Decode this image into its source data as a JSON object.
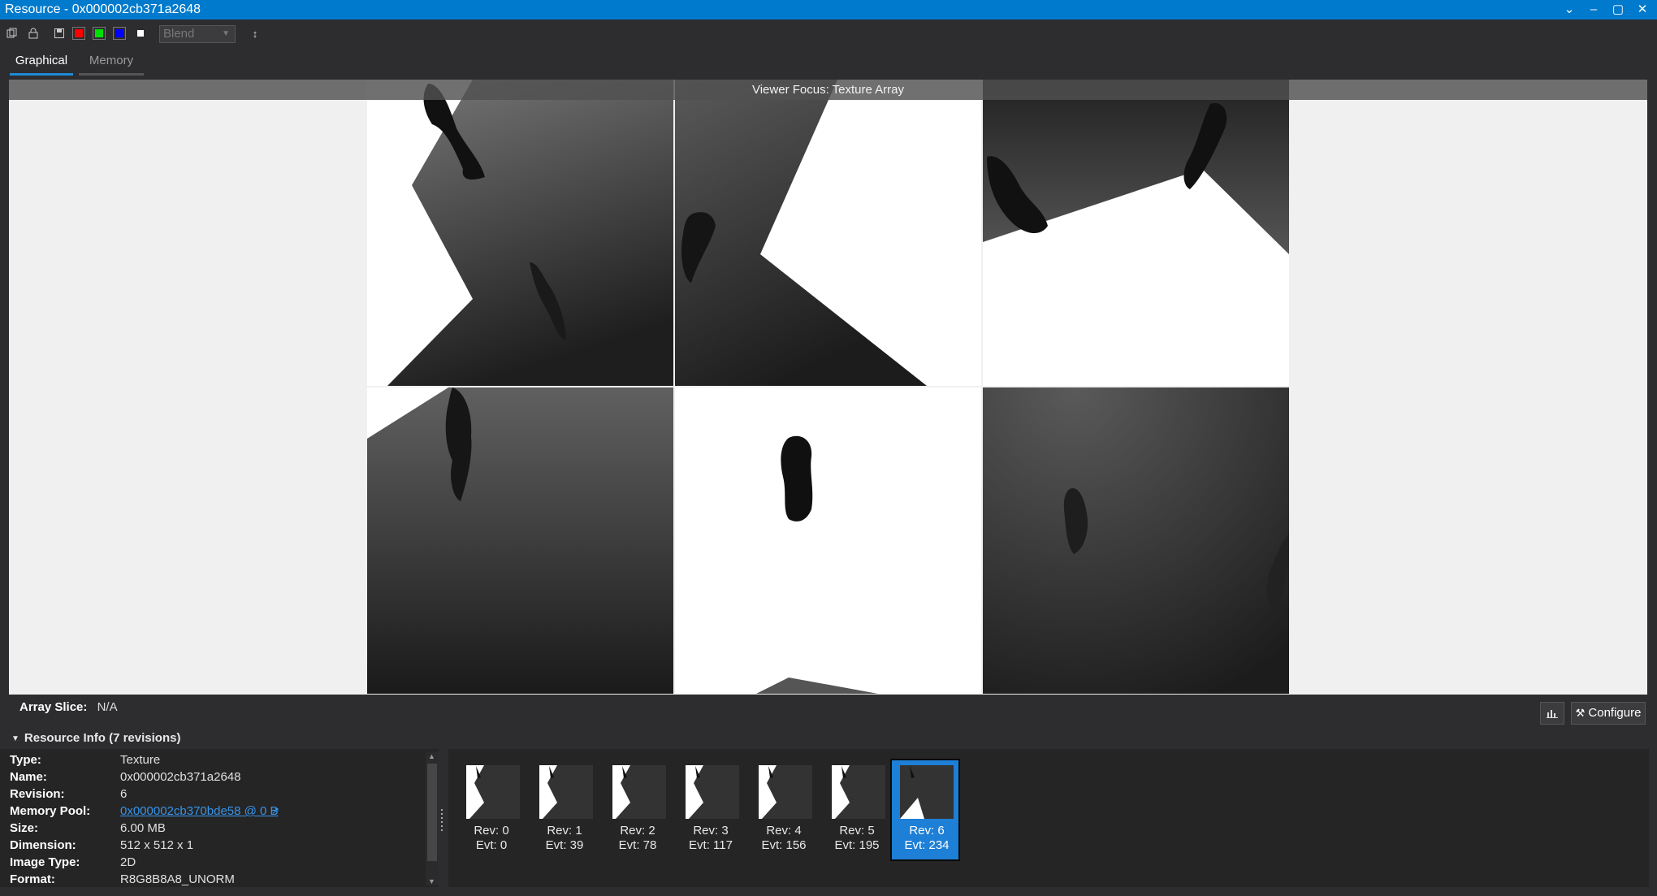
{
  "window": {
    "title": "Resource - 0x000002cb371a2648",
    "controls": [
      "menu-arrow",
      "minimize",
      "maximize",
      "close"
    ]
  },
  "toolbar": {
    "blend_value": "Blend",
    "swatches": [
      {
        "name": "red-channel",
        "color": "#ff0000"
      },
      {
        "name": "green-channel",
        "color": "#00e000"
      },
      {
        "name": "blue-channel",
        "color": "#0000ff"
      },
      {
        "name": "alpha-channel",
        "color": "#ffffff"
      }
    ]
  },
  "tabs": [
    {
      "label": "Graphical",
      "active": true
    },
    {
      "label": "Memory",
      "active": false
    }
  ],
  "viewer": {
    "focus_label": "Viewer Focus: Texture Array",
    "array_slice_label": "Array Slice:",
    "array_slice_value": "N/A",
    "configure_label": "Configure"
  },
  "resource_info": {
    "header": "Resource Info (7 revisions)",
    "rows": [
      {
        "key": "Type:",
        "value": "Texture"
      },
      {
        "key": "Name:",
        "value": "0x000002cb371a2648"
      },
      {
        "key": "Revision:",
        "value": "6"
      },
      {
        "key": "Memory Pool:",
        "value": "0x000002cb370bde58 @ 0 B",
        "link": true
      },
      {
        "key": "Size:",
        "value": "6.00 MB"
      },
      {
        "key": "Dimension:",
        "value": "512 x 512 x 1"
      },
      {
        "key": "Image Type:",
        "value": "2D"
      },
      {
        "key": "Format:",
        "value": "R8G8B8A8_UNORM"
      }
    ]
  },
  "revisions": [
    {
      "rev": "Rev: 0",
      "evt": "Evt: 0",
      "selected": false
    },
    {
      "rev": "Rev: 1",
      "evt": "Evt: 39",
      "selected": false
    },
    {
      "rev": "Rev: 2",
      "evt": "Evt: 78",
      "selected": false
    },
    {
      "rev": "Rev: 3",
      "evt": "Evt: 117",
      "selected": false
    },
    {
      "rev": "Rev: 4",
      "evt": "Evt: 156",
      "selected": false
    },
    {
      "rev": "Rev: 5",
      "evt": "Evt: 195",
      "selected": false
    },
    {
      "rev": "Rev: 6",
      "evt": "Evt: 234",
      "selected": true
    }
  ],
  "colors": {
    "accent": "#007acc",
    "selected_revision": "#1e7fd6",
    "link": "#3794e8",
    "background": "#2d2d30"
  }
}
